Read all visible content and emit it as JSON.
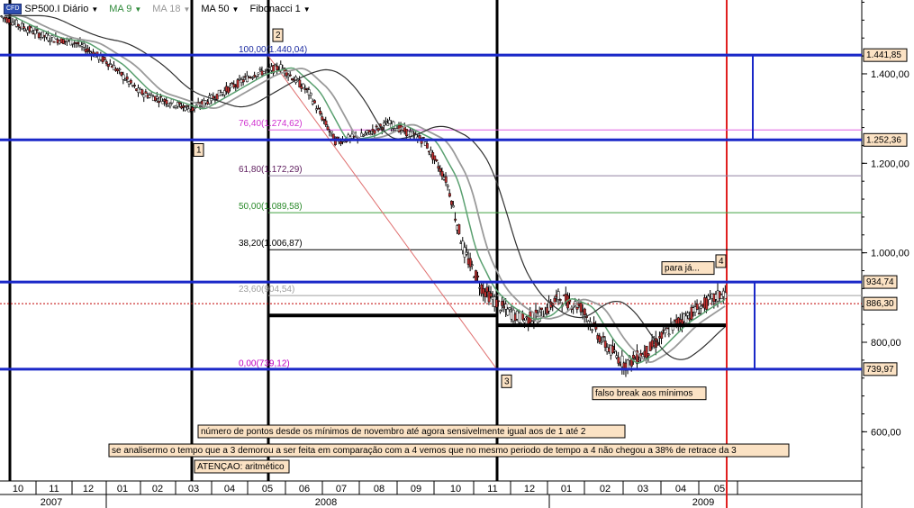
{
  "toolbar": {
    "symbol_badge": "CFD",
    "symbol": "SP500.I Diário",
    "ma1": "MA 9",
    "ma2": "MA 18",
    "ma3": "MA 50",
    "tool": "Fibonacci 1"
  },
  "chart_data": {
    "type": "line",
    "title": "",
    "y_ticks": [
      1400,
      1200,
      1000,
      800,
      600
    ],
    "y_tick_labels": [
      "1.400,00",
      "1.200,00",
      "1.000,00",
      "800,00",
      "600,00"
    ],
    "ylim": [
      490,
      1565
    ],
    "x_month_labels": [
      "10",
      "11",
      "12",
      "01",
      "02",
      "03",
      "04",
      "05",
      "06",
      "07",
      "08",
      "09",
      "10",
      "11",
      "12",
      "01",
      "02",
      "03",
      "04",
      "05"
    ],
    "x_year_labels": [
      "2007",
      "2008",
      "2009"
    ],
    "series": [
      {
        "values": [
          [
            2007.75,
            1530
          ],
          [
            2007.8,
            1505
          ],
          [
            2007.86,
            1480
          ],
          [
            2007.92,
            1470
          ],
          [
            2008.0,
            1420
          ],
          [
            2008.06,
            1360
          ],
          [
            2008.12,
            1340
          ],
          [
            2008.18,
            1320
          ],
          [
            2008.25,
            1360
          ],
          [
            2008.32,
            1400
          ],
          [
            2008.38,
            1415
          ],
          [
            2008.44,
            1360
          ],
          [
            2008.5,
            1250
          ],
          [
            2008.56,
            1260
          ],
          [
            2008.62,
            1290
          ],
          [
            2008.7,
            1250
          ],
          [
            2008.75,
            1160
          ],
          [
            2008.79,
            1000
          ],
          [
            2008.83,
            920
          ],
          [
            2008.87,
            880
          ],
          [
            2008.92,
            850
          ],
          [
            2008.96,
            860
          ],
          [
            2009.0,
            900
          ],
          [
            2009.05,
            880
          ],
          [
            2009.1,
            800
          ],
          [
            2009.15,
            750
          ],
          [
            2009.2,
            780
          ],
          [
            2009.26,
            840
          ],
          [
            2009.32,
            880
          ],
          [
            2009.37,
            910
          ]
        ]
      }
    ],
    "fibonacci_levels": [
      {
        "label": "100,00(1.440,04)",
        "value": 1440.04
      },
      {
        "label": "76,40(1.274,62)",
        "value": 1274.62
      },
      {
        "label": "61,80(1.172,29)",
        "value": 1172.29
      },
      {
        "label": "50,00(1.089,58)",
        "value": 1089.58
      },
      {
        "label": "38,20(1.006,87)",
        "value": 1006.87
      },
      {
        "label": "23,60(904,54)",
        "value": 904.54
      },
      {
        "label": "0,00(739,12)",
        "value": 739.12
      }
    ],
    "horizontal_lines": [
      {
        "label": "1.441,85",
        "value": 1441.85
      },
      {
        "label": "1.252,36",
        "value": 1252.36
      },
      {
        "label": "934,74",
        "value": 934.74
      },
      {
        "label": "739,97",
        "value": 739.97
      }
    ],
    "current_price": {
      "label": "886,30",
      "value": 886.3
    },
    "points": [
      {
        "label": "1",
        "value": 1256
      },
      {
        "label": "2",
        "value": 1440
      },
      {
        "label": "3",
        "value": 739
      },
      {
        "label": "4",
        "value": 935
      }
    ],
    "annotations": [
      "para já...",
      "falso break aos mínimos",
      "número de pontos desde os mínimos de novembro até agora sensivelmente igual aos de 1 até 2",
      "se analisermo o tempo que a 3 demorou a ser feita em comparação com a 4 vemos que no mesmo periodo de tempo a 4 não chegou a 38% de retrace da 3",
      "ATENÇAO: aritmético"
    ]
  }
}
